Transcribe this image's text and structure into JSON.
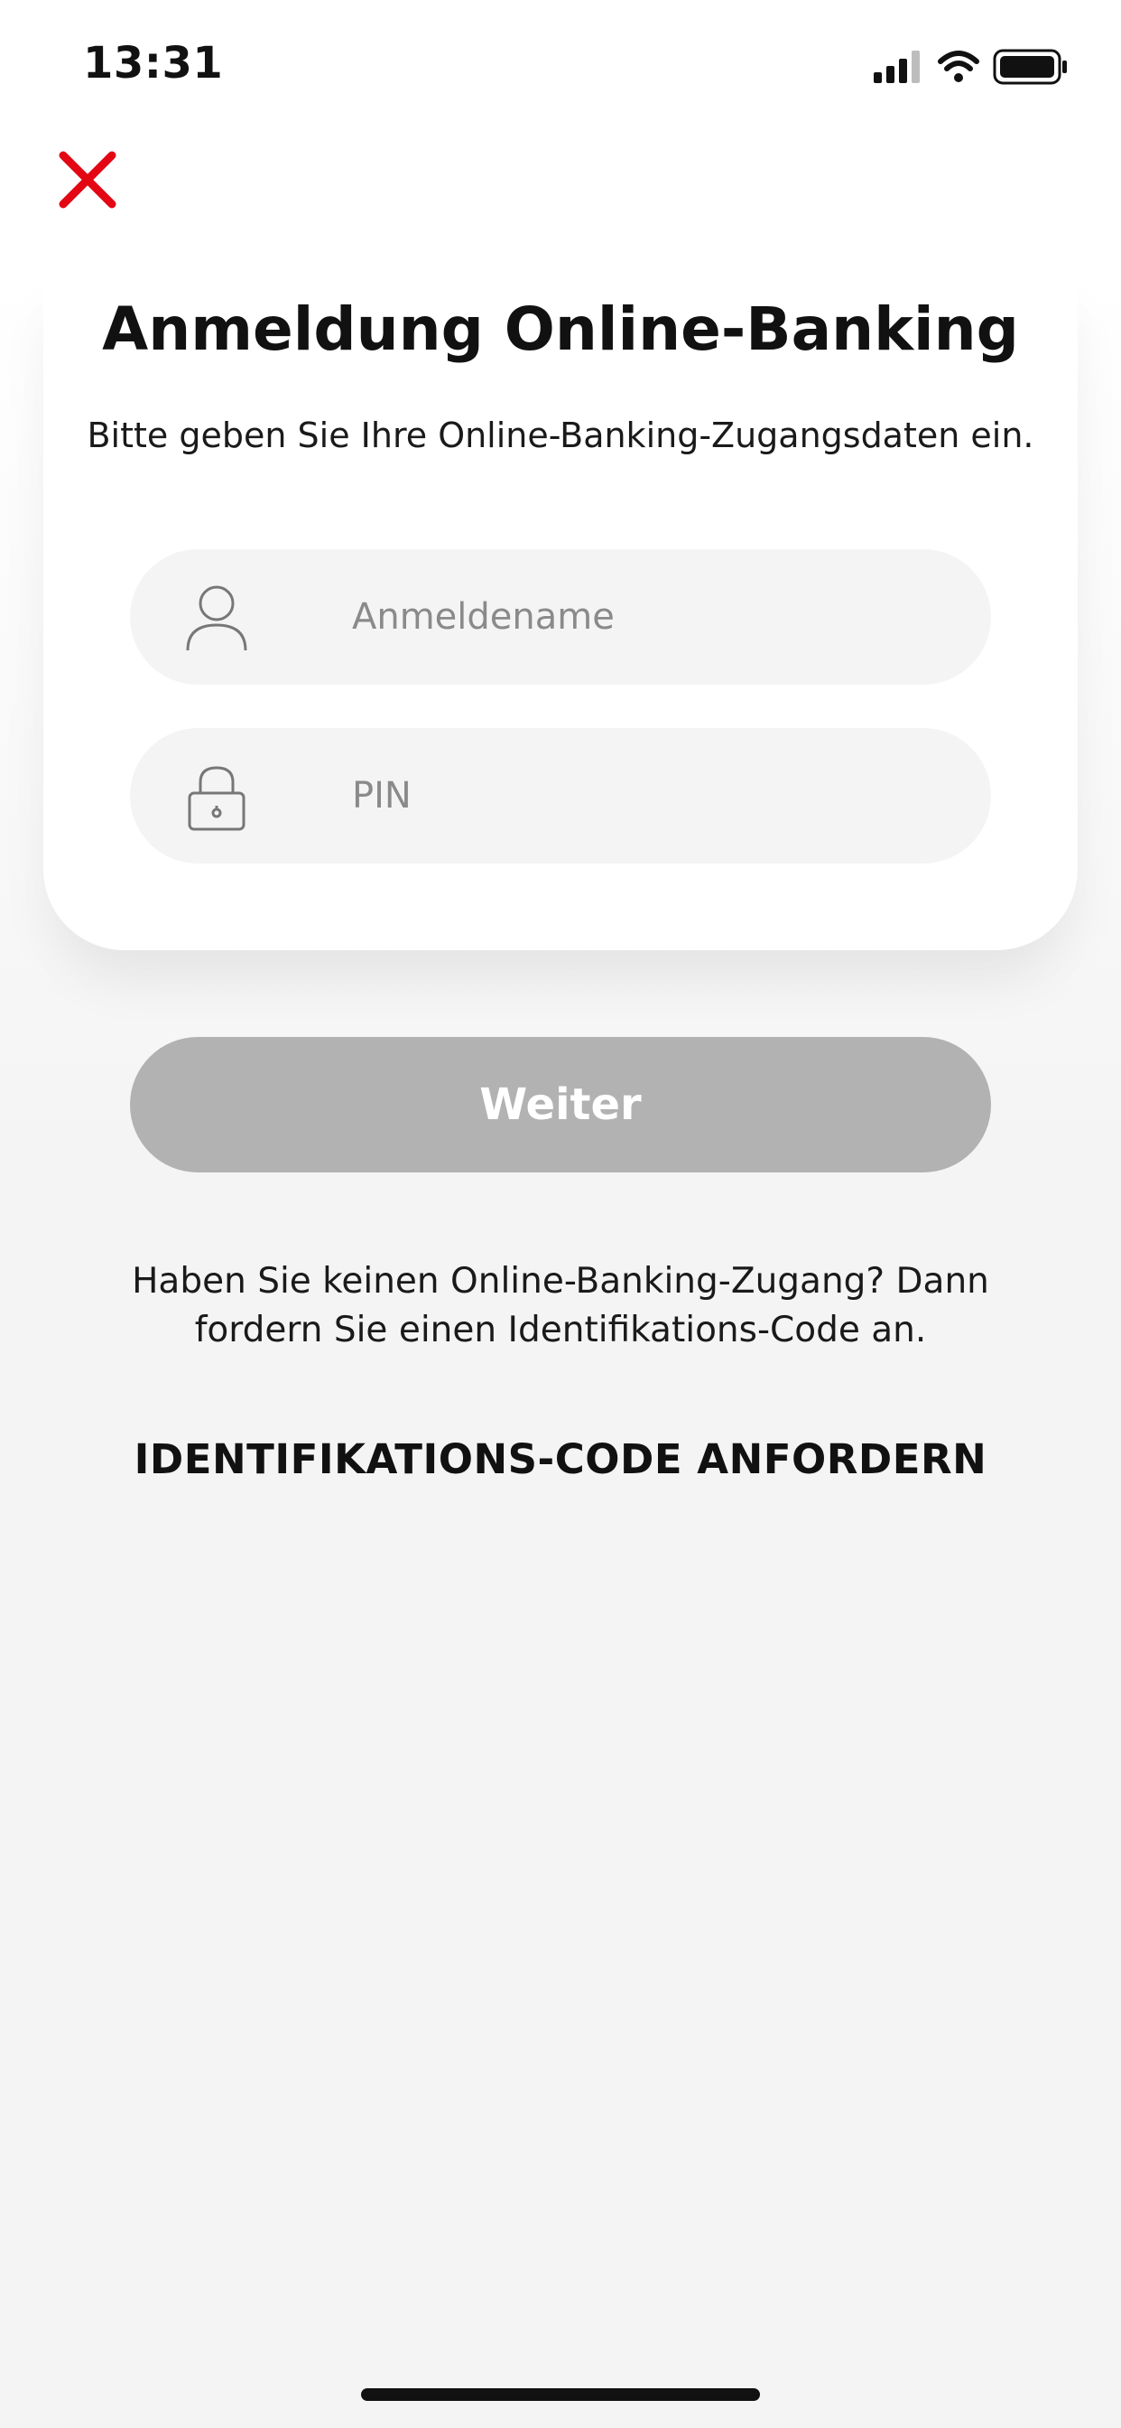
{
  "status_bar": {
    "time": "13:31",
    "icons": [
      "cellular-signal-icon",
      "wifi-icon",
      "battery-icon"
    ]
  },
  "close_button": {
    "icon": "close-icon",
    "color": "#e30613"
  },
  "card": {
    "title": "Anmeldung Online-Banking",
    "subtitle": "Bitte geben Sie Ihre Online-Banking-Zugangsdaten ein."
  },
  "form": {
    "username": {
      "placeholder": "Anmeldename",
      "value": "",
      "icon": "user-icon"
    },
    "pin": {
      "placeholder": "PIN",
      "value": "",
      "icon": "lock-icon"
    }
  },
  "continue_button": {
    "label": "Weiter",
    "color": "#b2b2b2"
  },
  "hint": {
    "text": "Haben Sie keinen Online-Banking-Zugang? Dann fordern Sie einen Identifikations-Code an."
  },
  "request_code": {
    "label": "IDENTIFIKATIONS-CODE ANFORDERN"
  }
}
